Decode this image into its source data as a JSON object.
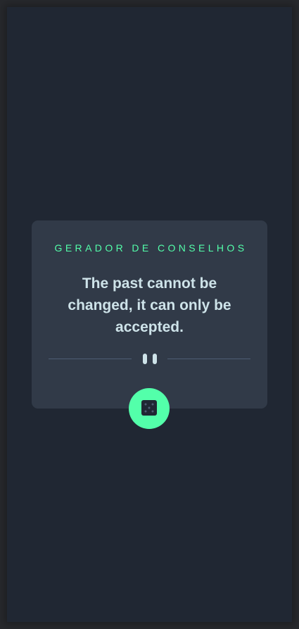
{
  "card": {
    "title": "GERADOR DE CONSELHOS",
    "advice": "The past cannot be changed, it can only be accepted."
  },
  "icons": {
    "divider": "pause-icon",
    "button": "dice-icon"
  },
  "colors": {
    "background": "#202733",
    "card": "#313a48",
    "accent": "#53ffaa",
    "text": "#cee3e9",
    "divider": "#4f5d74"
  }
}
